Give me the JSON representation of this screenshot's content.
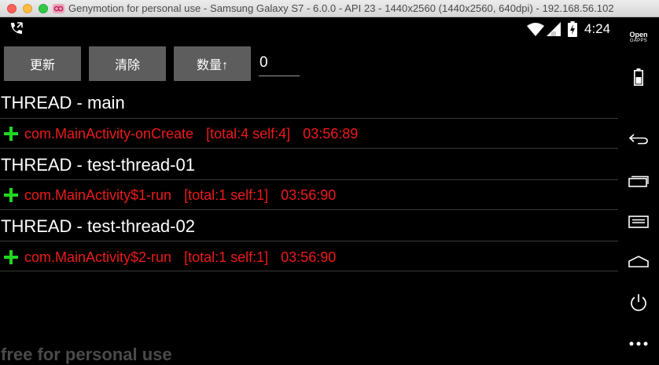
{
  "window": {
    "title": "Genymotion for personal use - Samsung Galaxy S7 - 6.0.0 - API 23 - 1440x2560 (1440x2560, 640dpi) - 192.168.56.102"
  },
  "status_bar": {
    "time": "4:24",
    "icons": [
      "call-forwarding-icon",
      "wifi-icon",
      "signal-icon",
      "battery-charging-icon"
    ]
  },
  "sidebar": {
    "opengapps_line1": "Open",
    "opengapps_line2": "GAPPS",
    "items": [
      "opengapps-icon",
      "battery-icon",
      "back-icon",
      "recent-apps-icon",
      "menu-icon",
      "home-icon",
      "power-icon",
      "more-icon"
    ]
  },
  "toolbar": {
    "refresh_label": "更新",
    "clear_label": "清除",
    "count_label": "数量↑",
    "count_value": "0"
  },
  "threads": [
    {
      "header": "THREAD - main",
      "methods": [
        {
          "name": "com.MainActivity-onCreate",
          "stats": "[total:4 self:4]",
          "time": "03:56:89"
        }
      ]
    },
    {
      "header": "THREAD - test-thread-01",
      "methods": [
        {
          "name": "com.MainActivity$1-run",
          "stats": "[total:1 self:1]",
          "time": "03:56:90"
        }
      ]
    },
    {
      "header": "THREAD - test-thread-02",
      "methods": [
        {
          "name": "com.MainActivity$2-run",
          "stats": "[total:1 self:1]",
          "time": "03:56:90"
        }
      ]
    }
  ],
  "watermark": "free for personal use",
  "colors": {
    "background": "#000000",
    "button": "#5d5d5d",
    "method_text": "#ee1a1a",
    "plus_icon": "#1fd81f"
  }
}
